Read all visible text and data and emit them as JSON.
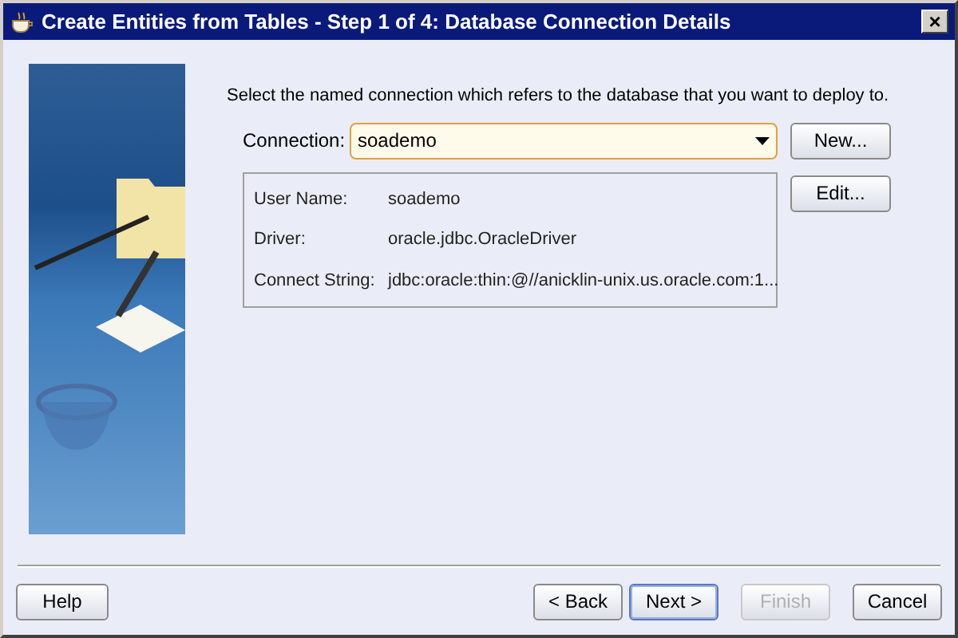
{
  "window": {
    "title": "Create Entities from Tables - Step 1 of 4: Database Connection Details",
    "close": "×"
  },
  "instruction": "Select the named connection which refers to the database that you want to deploy to.",
  "connection": {
    "label": "Connection:",
    "value": "soademo"
  },
  "details": [
    {
      "label": "User Name:",
      "value": "soademo"
    },
    {
      "label": "Driver:",
      "value": "oracle.jdbc.OracleDriver"
    },
    {
      "label": "Connect String:",
      "value": "jdbc:oracle:thin:@//anicklin-unix.us.oracle.com:1..."
    }
  ],
  "side_buttons": [
    "New...",
    "Edit..."
  ],
  "footer_buttons": [
    {
      "label": "Help",
      "disabled": false,
      "default": false
    },
    {
      "label": "< Back",
      "disabled": false,
      "default": false
    },
    {
      "label": "Next >",
      "disabled": false,
      "default": true
    },
    {
      "label": "Finish",
      "disabled": true,
      "default": false
    },
    {
      "label": "Cancel",
      "disabled": false,
      "default": false
    }
  ]
}
